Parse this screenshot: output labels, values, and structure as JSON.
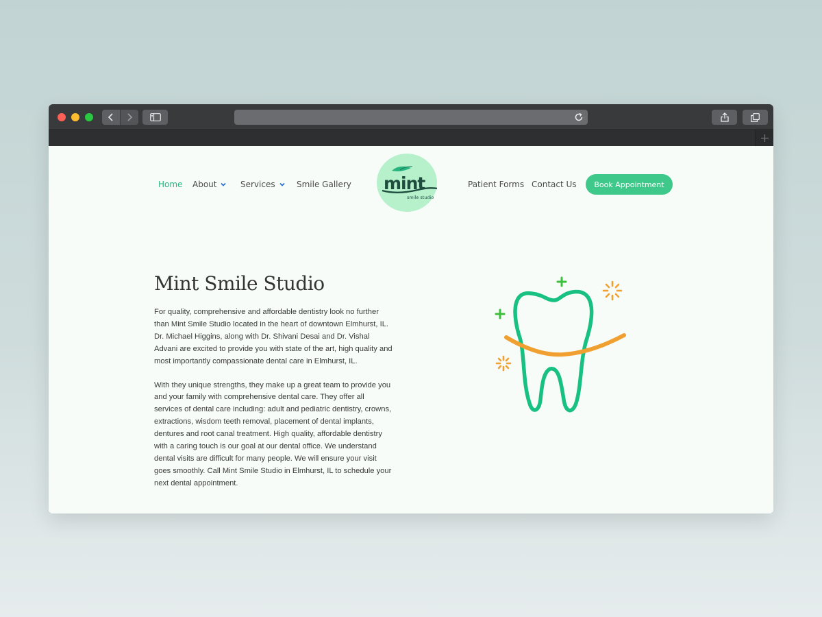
{
  "browser": {
    "url": "",
    "icons": {
      "back": "chevron-left-icon",
      "forward": "chevron-right-icon",
      "sidebar": "sidebar-icon",
      "reload": "reload-icon",
      "share": "share-icon",
      "tabs": "tabs-overview-icon",
      "new_tab": "plus-icon"
    }
  },
  "nav": {
    "home": "Home",
    "about": "About",
    "services": "Services",
    "gallery": "Smile Gallery",
    "forms": "Patient Forms",
    "contact": "Contact Us",
    "book": "Book Appointment"
  },
  "logo": {
    "word": "mint",
    "tagline": "smile studio"
  },
  "main": {
    "title": "Mint Smile Studio",
    "para1": "For quality, comprehensive and affordable dentistry look no further than Mint Smile Studio located in the heart of downtown Elmhurst, IL. Dr. Michael Higgins, along with Dr. Shivani Desai and Dr. Vishal Advani are excited to provide you with state of the art, high quality and most importantly compassionate dental care in Elmhurst, IL.",
    "para2": "With they unique strengths, they make up a great team to provide you and your family with comprehensive dental care. They offer all services of dental care including: adult and pediatric dentistry, crowns, extractions, wisdom teeth removal, placement of dental implants, dentures and root canal treatment. High quality, affordable dentistry with a caring touch is our goal at our dental office. We understand dental visits are difficult for many people. We will ensure your visit goes smoothly. Call Mint Smile Studio in Elmhurst, IL to schedule your next dental appointment."
  },
  "colors": {
    "accent": "#27b37f",
    "button": "#3ec98a",
    "logo_bg": "#b6f1cb",
    "tooth_outline": "#18c182",
    "smile": "#f0a030"
  },
  "illustration": "tooth-smile-icon"
}
